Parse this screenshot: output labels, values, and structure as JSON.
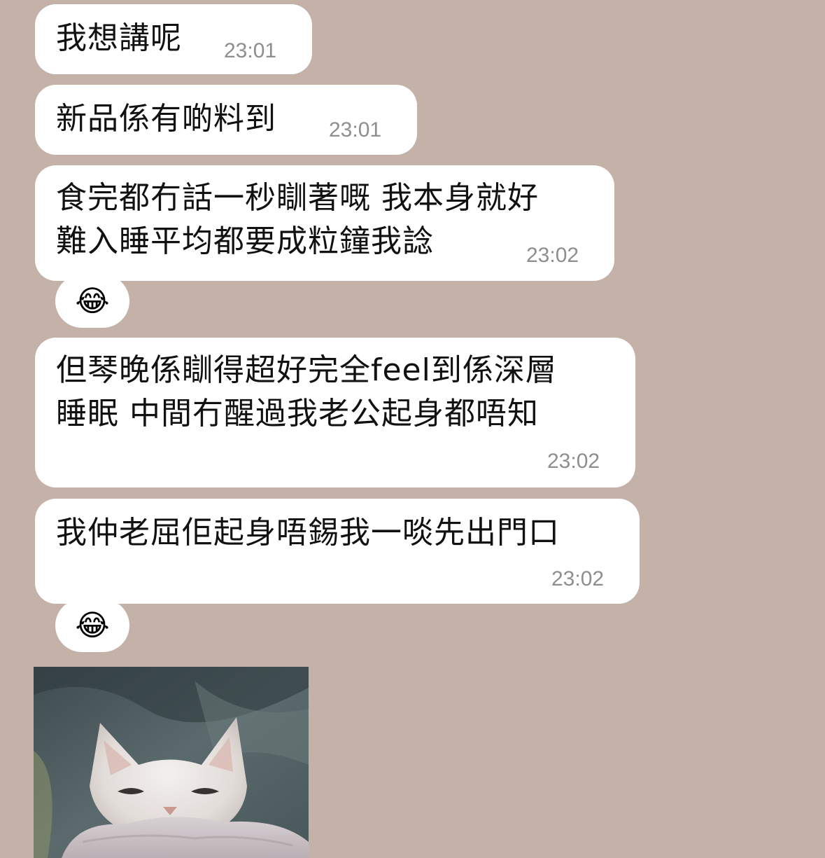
{
  "messages": [
    {
      "text": "我想講呢",
      "time": "23:01"
    },
    {
      "text": "新品係有啲料到",
      "time": "23:01"
    },
    {
      "text": "食完都冇話一秒瞓著嘅 我本身就好\n難入睡平均都要成粒鐘我諗",
      "time": "23:02",
      "reaction": "😂"
    },
    {
      "text": "但琴晚係瞓得超好完全feel到係深層\n睡眠 中間冇醒過我老公起身都唔知",
      "time": "23:02"
    },
    {
      "text": "我仲老屈佢起身唔錫我一啖先出門口",
      "time": "23:02",
      "reaction": "😂"
    }
  ],
  "photo": {
    "subject": "cat-photo"
  },
  "colors": {
    "background": "#c4b2a8",
    "bubble": "#ffffff",
    "time_text": "#8e8e8e"
  }
}
